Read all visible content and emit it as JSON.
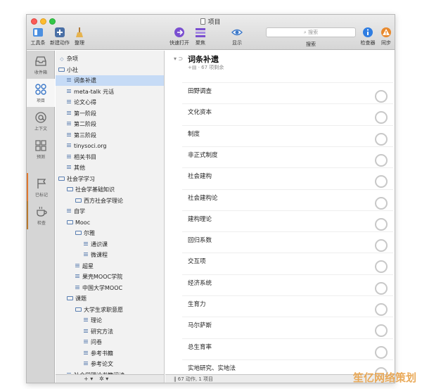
{
  "window": {
    "title": "项目"
  },
  "toolbar": {
    "inbox_label": "工具条",
    "new_action_label": "新建动作",
    "clean_label": "整理",
    "quick_open_label": "快速打开",
    "focus_label": "聚焦",
    "view_label": "显示",
    "search_placeholder": "搜索",
    "search_label": "搜索",
    "inspector_label": "检查器",
    "sync_label": "同步"
  },
  "perspectives": [
    {
      "label": "收件箱",
      "icon": "inbox-icon"
    },
    {
      "label": "项目",
      "icon": "projects-icon"
    },
    {
      "label": "上下文",
      "icon": "contexts-icon"
    },
    {
      "label": "预测",
      "icon": "forecast-icon"
    },
    {
      "label": "已标记",
      "icon": "flag-icon"
    },
    {
      "label": "检查",
      "icon": "review-icon"
    }
  ],
  "outline": [
    {
      "label": "杂项",
      "indent": 0,
      "kind": "misc"
    },
    {
      "label": "小社",
      "indent": 0,
      "kind": "folder"
    },
    {
      "label": "词条补遗",
      "indent": 1,
      "kind": "project",
      "selected": true
    },
    {
      "label": "meta-talk 元话",
      "indent": 1,
      "kind": "project"
    },
    {
      "label": "论文心得",
      "indent": 1,
      "kind": "project"
    },
    {
      "label": "第一阶段",
      "indent": 1,
      "kind": "project"
    },
    {
      "label": "第二阶段",
      "indent": 1,
      "kind": "project"
    },
    {
      "label": "第三阶段",
      "indent": 1,
      "kind": "project"
    },
    {
      "label": "tinysoci.org",
      "indent": 1,
      "kind": "project"
    },
    {
      "label": "相关书目",
      "indent": 1,
      "kind": "project"
    },
    {
      "label": "其他",
      "indent": 1,
      "kind": "project"
    },
    {
      "label": "社会学学习",
      "indent": 0,
      "kind": "folder"
    },
    {
      "label": "社会学基础知识",
      "indent": 1,
      "kind": "folder"
    },
    {
      "label": "西方社会学理论",
      "indent": 2,
      "kind": "folder"
    },
    {
      "label": "自学",
      "indent": 1,
      "kind": "project"
    },
    {
      "label": "Mooc",
      "indent": 1,
      "kind": "folder"
    },
    {
      "label": "尔雅",
      "indent": 2,
      "kind": "folder"
    },
    {
      "label": "通识课",
      "indent": 3,
      "kind": "project"
    },
    {
      "label": "微课程",
      "indent": 3,
      "kind": "project"
    },
    {
      "label": "超星",
      "indent": 2,
      "kind": "project"
    },
    {
      "label": "果壳MOOC学院",
      "indent": 2,
      "kind": "project"
    },
    {
      "label": "中国大学MOOC",
      "indent": 2,
      "kind": "project"
    },
    {
      "label": "课题",
      "indent": 1,
      "kind": "folder"
    },
    {
      "label": "大学生求职意愿",
      "indent": 2,
      "kind": "folder"
    },
    {
      "label": "理论",
      "indent": 3,
      "kind": "project"
    },
    {
      "label": "研究方法",
      "indent": 3,
      "kind": "project"
    },
    {
      "label": "问卷",
      "indent": 3,
      "kind": "project"
    },
    {
      "label": "参考书籍",
      "indent": 3,
      "kind": "project"
    },
    {
      "label": "参考论文",
      "indent": 3,
      "kind": "project"
    },
    {
      "label": "社会学理论书籍阅读",
      "indent": 1,
      "kind": "project"
    }
  ],
  "outline_footer": {
    "add": "+ ▾",
    "gear": "✲ ▾"
  },
  "project": {
    "title": "词条补遗",
    "subtitle": "+▤ · 67 项剩余"
  },
  "tasks": [
    "田野调查",
    "文化资本",
    "制度",
    "非正式制度",
    "社会建构",
    "社会建构论",
    "建构理论",
    "回归系数",
    "交互项",
    "经济系统",
    "生育力",
    "马尔萨斯",
    "总生育率",
    "实地研究、实地法"
  ],
  "status": {
    "text": "67 动作, 1 项目"
  },
  "watermark": "笙亿网络策划"
}
